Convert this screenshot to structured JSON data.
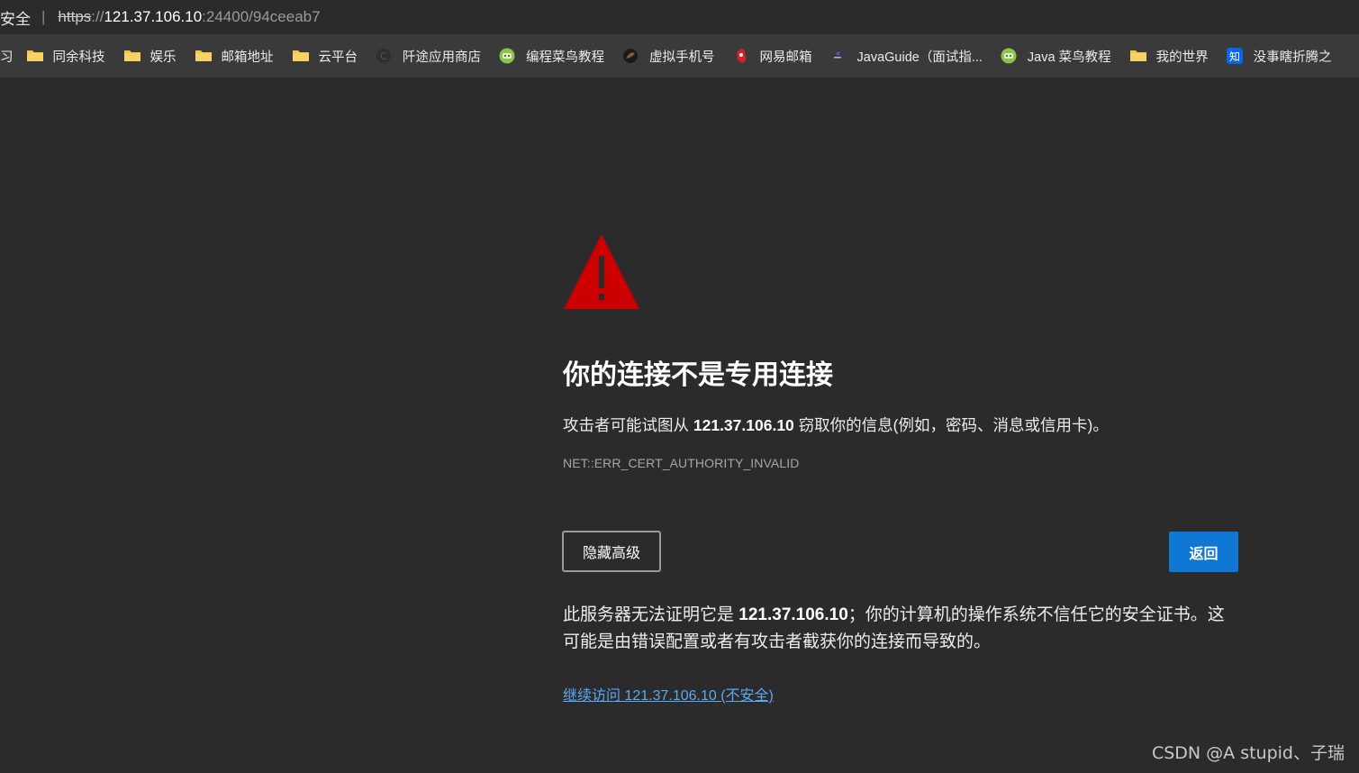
{
  "address_bar": {
    "security_label": "安全",
    "url_scheme": "https",
    "url_separator": "://",
    "url_host": "121.37.106.10",
    "url_rest": ":24400/94ceeab7"
  },
  "bookmarks": [
    {
      "label": "习",
      "icon": "none"
    },
    {
      "label": "同余科技",
      "icon": "folder-icon"
    },
    {
      "label": "娱乐",
      "icon": "folder-icon"
    },
    {
      "label": "邮箱地址",
      "icon": "folder-icon"
    },
    {
      "label": "云平台",
      "icon": "folder-icon"
    },
    {
      "label": "阡途应用商店",
      "icon": "app-store-icon"
    },
    {
      "label": "编程菜鸟教程",
      "icon": "runoob-icon"
    },
    {
      "label": "虚拟手机号",
      "icon": "phone-icon"
    },
    {
      "label": "网易邮箱",
      "icon": "netease-icon"
    },
    {
      "label": "JavaGuide（面试指...",
      "icon": "javaguide-icon"
    },
    {
      "label": "Java 菜鸟教程",
      "icon": "runoob-icon"
    },
    {
      "label": "我的世界",
      "icon": "folder-icon"
    },
    {
      "label": "没事瞎折腾之",
      "icon": "zhihu-icon"
    }
  ],
  "page": {
    "title": "你的连接不是专用连接",
    "desc_prefix": "攻击者可能试图从 ",
    "desc_host": "121.37.106.10",
    "desc_suffix": " 窃取你的信息(例如，密码、消息或信用卡)。",
    "error_code": "NET::ERR_CERT_AUTHORITY_INVALID",
    "hide_advanced_label": "隐藏高级",
    "back_label": "返回",
    "explain_prefix": "此服务器无法证明它是 ",
    "explain_host": "121.37.106.10",
    "explain_suffix": "；你的计算机的操作系统不信任它的安全证书。这可能是由错误配置或者有攻击者截获你的连接而导致的。",
    "proceed_link": "继续访问 121.37.106.10 (不安全)"
  },
  "watermark": "CSDN @A stupid、子瑞",
  "colors": {
    "background": "#2b2b2b",
    "bookmark_bar": "#3a3a3a",
    "warning_red": "#cc0000",
    "primary_button": "#0f78d4",
    "link": "#5aa9f5",
    "folder": "#f3c544"
  }
}
